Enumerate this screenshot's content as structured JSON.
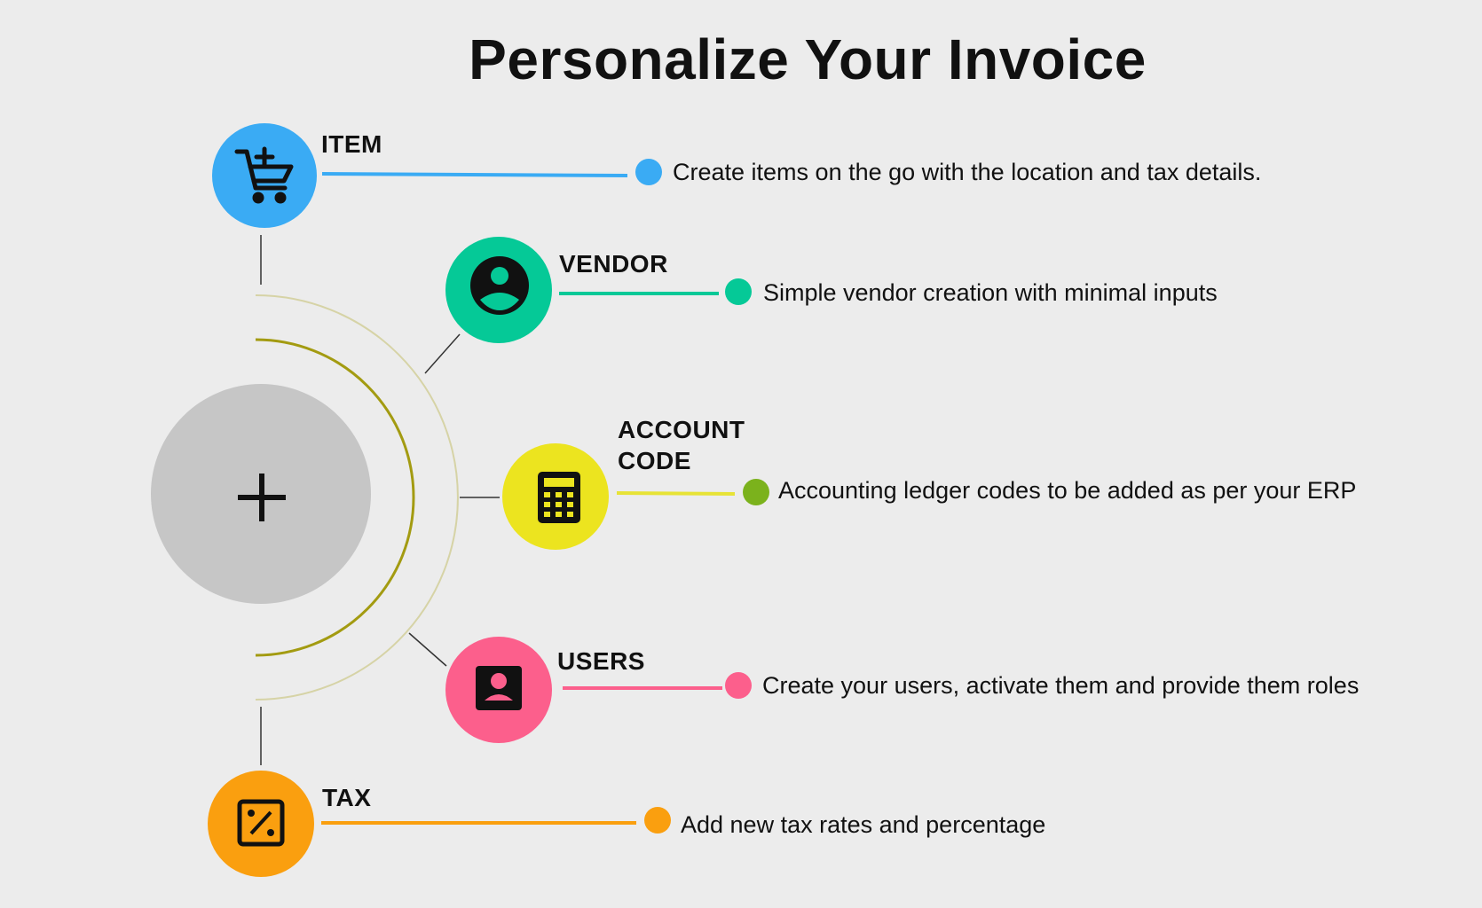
{
  "page": {
    "title": "Personalize Your Invoice"
  },
  "hub": {
    "icon": "plus-icon"
  },
  "features": [
    {
      "key": "item",
      "label": "ITEM",
      "label_line2": "",
      "icon": "cart-add-icon",
      "color": "#3aabf4",
      "dot_color": "#3aabf4",
      "line_color": "#3aabf4",
      "description": "Create items on the go with the location and tax details."
    },
    {
      "key": "vendor",
      "label": "VENDOR",
      "label_line2": "",
      "icon": "account-circle-icon",
      "color": "#05c997",
      "dot_color": "#05c997",
      "line_color": "#05c997",
      "description": "Simple vendor creation with minimal inputs"
    },
    {
      "key": "account-code",
      "label": "ACCOUNT",
      "label_line2": "CODE",
      "icon": "calculator-icon",
      "color": "#ece41f",
      "dot_color": "#7bb21c",
      "line_color": "#e7e336",
      "description": "Accounting ledger codes to be added as per your ERP"
    },
    {
      "key": "users",
      "label": "USERS",
      "label_line2": "",
      "icon": "user-badge-icon",
      "color": "#fc5f8c",
      "dot_color": "#fc5f8c",
      "line_color": "#fc5f8c",
      "description": "Create your users, activate them and provide them roles"
    },
    {
      "key": "tax",
      "label": "TAX",
      "label_line2": "",
      "icon": "percent-box-icon",
      "color": "#fa9f0f",
      "dot_color": "#fa9f0f",
      "line_color": "#fa9f0f",
      "description": "Add new tax rates and percentage"
    }
  ],
  "colors": {
    "background": "#ececec",
    "hub": "#c6c6c6",
    "inner_arc": "#a39b11",
    "outer_arc": "#d6d3a6",
    "connector": "#333333"
  }
}
